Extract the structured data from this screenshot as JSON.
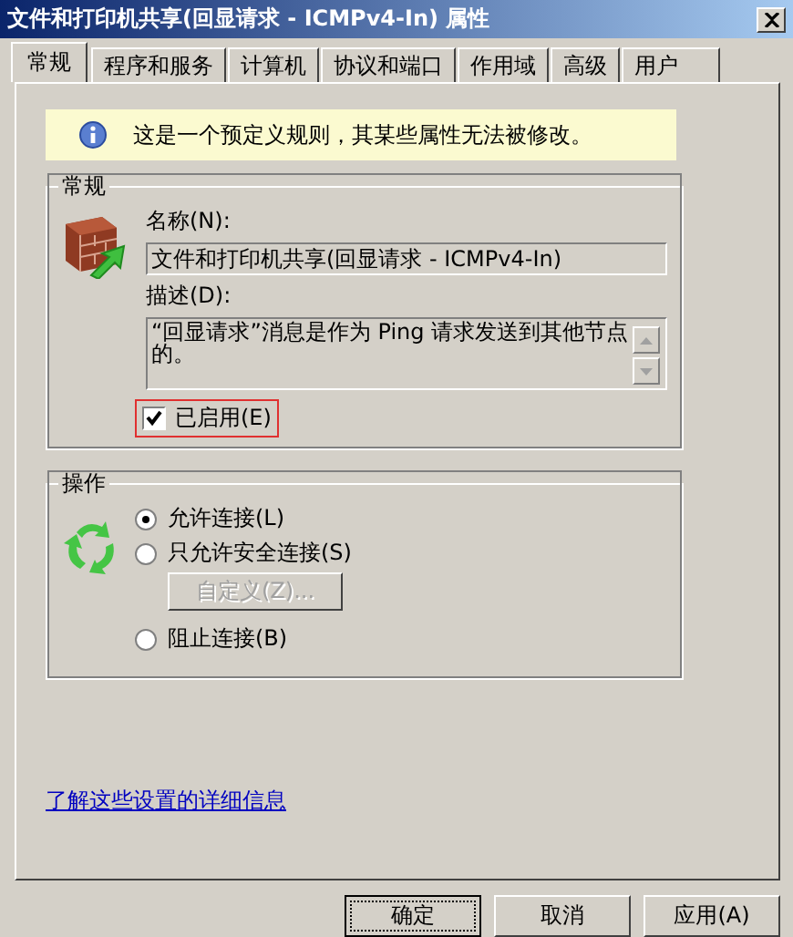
{
  "window": {
    "title": "文件和打印机共享(回显请求 - ICMPv4-In) 属性"
  },
  "tabs": [
    {
      "label": "常规",
      "selected": true
    },
    {
      "label": "程序和服务",
      "selected": false
    },
    {
      "label": "计算机",
      "selected": false
    },
    {
      "label": "协议和端口",
      "selected": false
    },
    {
      "label": "作用域",
      "selected": false
    },
    {
      "label": "高级",
      "selected": false
    },
    {
      "label": "用户",
      "selected": false
    }
  ],
  "info_banner": {
    "text": "这是一个预定义规则，其某些属性无法被修改。"
  },
  "general_group": {
    "title": "常规",
    "name_label": "名称(N):",
    "name_value": "文件和打印机共享(回显请求 - ICMPv4-In)",
    "description_label": "描述(D):",
    "description_value": "“回显请求”消息是作为 Ping 请求发送到其他节点的。",
    "enabled": {
      "label": "已启用(E)",
      "checked": true
    }
  },
  "action_group": {
    "title": "操作",
    "options": [
      {
        "label": "允许连接(L)",
        "selected": true
      },
      {
        "label": "只允许安全连接(S)",
        "selected": false,
        "button": {
          "label": "自定义(Z)...",
          "disabled": true
        }
      },
      {
        "label": "阻止连接(B)",
        "selected": false
      }
    ]
  },
  "link": "了解这些设置的详细信息",
  "buttons": [
    "确定",
    "取消",
    "应用(A)"
  ]
}
